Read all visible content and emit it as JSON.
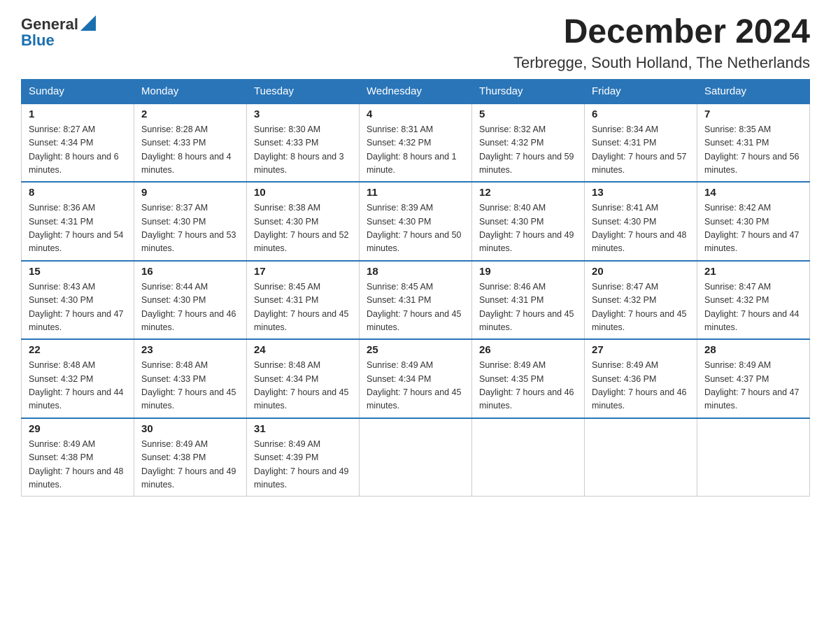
{
  "logo": {
    "text_general": "General",
    "text_blue": "Blue"
  },
  "header": {
    "month_year": "December 2024",
    "location": "Terbregge, South Holland, The Netherlands"
  },
  "days_of_week": [
    "Sunday",
    "Monday",
    "Tuesday",
    "Wednesday",
    "Thursday",
    "Friday",
    "Saturday"
  ],
  "weeks": [
    [
      {
        "day": "1",
        "sunrise": "8:27 AM",
        "sunset": "4:34 PM",
        "daylight": "8 hours and 6 minutes."
      },
      {
        "day": "2",
        "sunrise": "8:28 AM",
        "sunset": "4:33 PM",
        "daylight": "8 hours and 4 minutes."
      },
      {
        "day": "3",
        "sunrise": "8:30 AM",
        "sunset": "4:33 PM",
        "daylight": "8 hours and 3 minutes."
      },
      {
        "day": "4",
        "sunrise": "8:31 AM",
        "sunset": "4:32 PM",
        "daylight": "8 hours and 1 minute."
      },
      {
        "day": "5",
        "sunrise": "8:32 AM",
        "sunset": "4:32 PM",
        "daylight": "7 hours and 59 minutes."
      },
      {
        "day": "6",
        "sunrise": "8:34 AM",
        "sunset": "4:31 PM",
        "daylight": "7 hours and 57 minutes."
      },
      {
        "day": "7",
        "sunrise": "8:35 AM",
        "sunset": "4:31 PM",
        "daylight": "7 hours and 56 minutes."
      }
    ],
    [
      {
        "day": "8",
        "sunrise": "8:36 AM",
        "sunset": "4:31 PM",
        "daylight": "7 hours and 54 minutes."
      },
      {
        "day": "9",
        "sunrise": "8:37 AM",
        "sunset": "4:30 PM",
        "daylight": "7 hours and 53 minutes."
      },
      {
        "day": "10",
        "sunrise": "8:38 AM",
        "sunset": "4:30 PM",
        "daylight": "7 hours and 52 minutes."
      },
      {
        "day": "11",
        "sunrise": "8:39 AM",
        "sunset": "4:30 PM",
        "daylight": "7 hours and 50 minutes."
      },
      {
        "day": "12",
        "sunrise": "8:40 AM",
        "sunset": "4:30 PM",
        "daylight": "7 hours and 49 minutes."
      },
      {
        "day": "13",
        "sunrise": "8:41 AM",
        "sunset": "4:30 PM",
        "daylight": "7 hours and 48 minutes."
      },
      {
        "day": "14",
        "sunrise": "8:42 AM",
        "sunset": "4:30 PM",
        "daylight": "7 hours and 47 minutes."
      }
    ],
    [
      {
        "day": "15",
        "sunrise": "8:43 AM",
        "sunset": "4:30 PM",
        "daylight": "7 hours and 47 minutes."
      },
      {
        "day": "16",
        "sunrise": "8:44 AM",
        "sunset": "4:30 PM",
        "daylight": "7 hours and 46 minutes."
      },
      {
        "day": "17",
        "sunrise": "8:45 AM",
        "sunset": "4:31 PM",
        "daylight": "7 hours and 45 minutes."
      },
      {
        "day": "18",
        "sunrise": "8:45 AM",
        "sunset": "4:31 PM",
        "daylight": "7 hours and 45 minutes."
      },
      {
        "day": "19",
        "sunrise": "8:46 AM",
        "sunset": "4:31 PM",
        "daylight": "7 hours and 45 minutes."
      },
      {
        "day": "20",
        "sunrise": "8:47 AM",
        "sunset": "4:32 PM",
        "daylight": "7 hours and 45 minutes."
      },
      {
        "day": "21",
        "sunrise": "8:47 AM",
        "sunset": "4:32 PM",
        "daylight": "7 hours and 44 minutes."
      }
    ],
    [
      {
        "day": "22",
        "sunrise": "8:48 AM",
        "sunset": "4:32 PM",
        "daylight": "7 hours and 44 minutes."
      },
      {
        "day": "23",
        "sunrise": "8:48 AM",
        "sunset": "4:33 PM",
        "daylight": "7 hours and 45 minutes."
      },
      {
        "day": "24",
        "sunrise": "8:48 AM",
        "sunset": "4:34 PM",
        "daylight": "7 hours and 45 minutes."
      },
      {
        "day": "25",
        "sunrise": "8:49 AM",
        "sunset": "4:34 PM",
        "daylight": "7 hours and 45 minutes."
      },
      {
        "day": "26",
        "sunrise": "8:49 AM",
        "sunset": "4:35 PM",
        "daylight": "7 hours and 46 minutes."
      },
      {
        "day": "27",
        "sunrise": "8:49 AM",
        "sunset": "4:36 PM",
        "daylight": "7 hours and 46 minutes."
      },
      {
        "day": "28",
        "sunrise": "8:49 AM",
        "sunset": "4:37 PM",
        "daylight": "7 hours and 47 minutes."
      }
    ],
    [
      {
        "day": "29",
        "sunrise": "8:49 AM",
        "sunset": "4:38 PM",
        "daylight": "7 hours and 48 minutes."
      },
      {
        "day": "30",
        "sunrise": "8:49 AM",
        "sunset": "4:38 PM",
        "daylight": "7 hours and 49 minutes."
      },
      {
        "day": "31",
        "sunrise": "8:49 AM",
        "sunset": "4:39 PM",
        "daylight": "7 hours and 49 minutes."
      },
      null,
      null,
      null,
      null
    ]
  ]
}
